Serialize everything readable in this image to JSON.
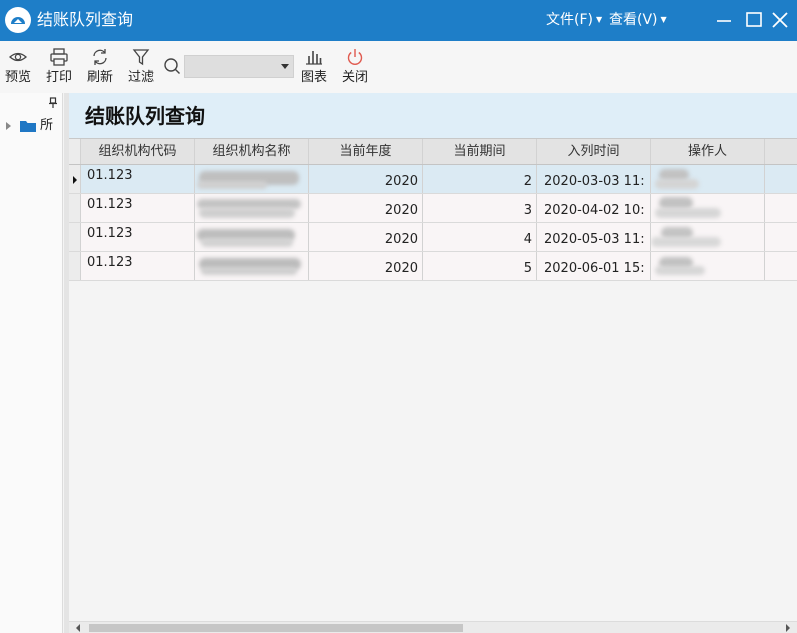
{
  "window": {
    "title": "结账队列查询",
    "menus": [
      {
        "label": "文件(F)"
      },
      {
        "label": "查看(V)"
      }
    ]
  },
  "toolbar": {
    "buttons": [
      {
        "label": "预览",
        "icon": "eye-icon"
      },
      {
        "label": "打印",
        "icon": "printer-icon"
      },
      {
        "label": "刷新",
        "icon": "refresh-icon"
      },
      {
        "label": "过滤",
        "icon": "filter-icon"
      },
      {
        "label": "图表",
        "icon": "bar-chart-icon"
      },
      {
        "label": "关闭",
        "icon": "power-icon"
      }
    ],
    "search": {
      "value": "",
      "placeholder": ""
    }
  },
  "tree": {
    "root_label": "所"
  },
  "page": {
    "title": "结账队列查询"
  },
  "grid": {
    "columns": [
      "组织机构代码",
      "组织机构名称",
      "当前年度",
      "当前期间",
      "入列时间",
      "操作人"
    ],
    "rows": [
      {
        "code": "01.123",
        "year": "2020",
        "period": "2",
        "time": "2020-03-03 11:"
      },
      {
        "code": "01.123",
        "year": "2020",
        "period": "3",
        "time": "2020-04-02 10:"
      },
      {
        "code": "01.123",
        "year": "2020",
        "period": "4",
        "time": "2020-05-03 11:"
      },
      {
        "code": "01.123",
        "year": "2020",
        "period": "5",
        "time": "2020-06-01 15:"
      }
    ]
  },
  "colors": {
    "titlebar": "#1e7ec8",
    "header_band": "#dfeef8",
    "selected_row": "#dbeaf3",
    "close_icon": "#e05a4f",
    "folder": "#1f77c4"
  }
}
